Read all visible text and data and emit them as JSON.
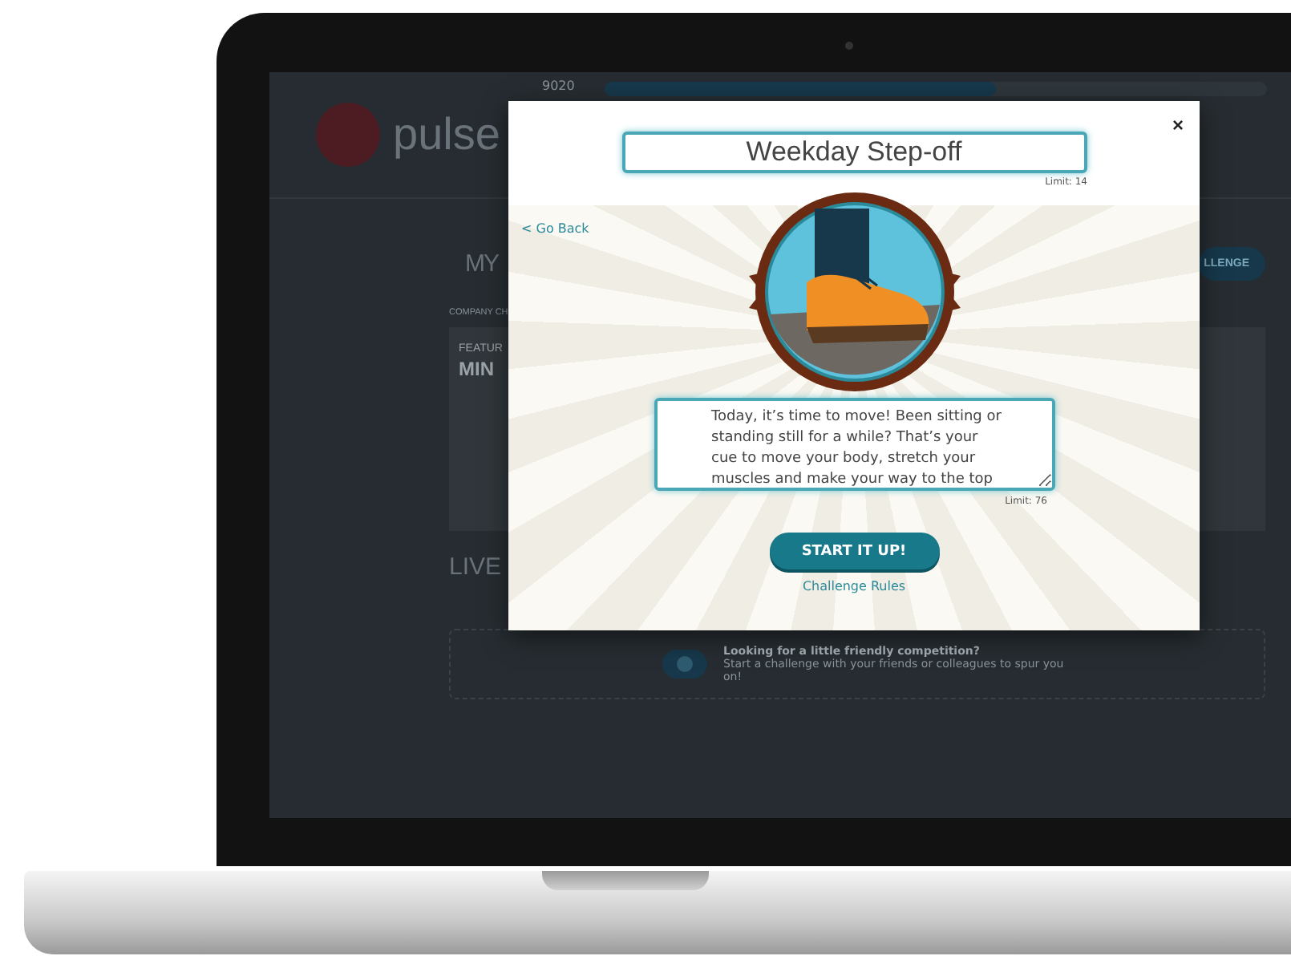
{
  "background_page": {
    "logo_text": "pulse",
    "steps_count": "9020",
    "heading": "MY",
    "section_label": "COMPANY CH",
    "progress": {
      "level": 0.59
    },
    "featured_label": "FEATUR",
    "featured_title": "MIN",
    "live_heading": "LIVE",
    "challenge_button": "LLENGE",
    "competition": {
      "title": "Looking for a little friendly competition?",
      "text": "Start a challenge with your friends or colleagues to spur you on!"
    }
  },
  "modal": {
    "title_field": {
      "value": "Weekday Step-off",
      "limit": "Limit: 14"
    },
    "back_link": "< Go Back",
    "close": "×",
    "description_field": {
      "value": "Today, it’s time to move! Been sitting or standing still for a while? That’s your cue to move your body, stretch your muscles and make your way to the top",
      "limit": "Limit: 76"
    },
    "primary_button": "START IT UP!",
    "rules_link": "Challenge Rules"
  }
}
